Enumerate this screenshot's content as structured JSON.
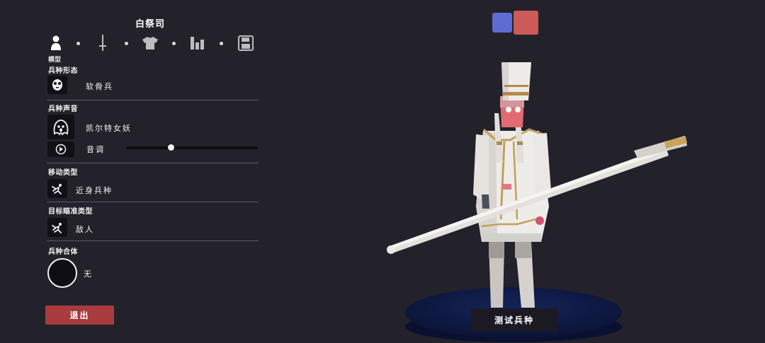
{
  "unit_name": "白祭司",
  "tabs": [
    {
      "name": "model",
      "caption": "模型",
      "icon": "person-icon",
      "active": true
    },
    {
      "name": "weapon",
      "icon": "sword-icon"
    },
    {
      "name": "clothing",
      "icon": "shirt-icon"
    },
    {
      "name": "stats",
      "icon": "bar-chart-icon"
    },
    {
      "name": "save",
      "icon": "save-icon"
    }
  ],
  "sections": {
    "unit_base": {
      "label": "兵种形态",
      "value": "软骨兵",
      "icon": "skull-mask-icon"
    },
    "unit_voice": {
      "label": "兵种声音",
      "value": "凯尔特女妖",
      "icon": "banshee-icon",
      "pitch_label": "音调",
      "pitch_value": 0.34,
      "play_icon": "play-icon"
    },
    "movement": {
      "label": "移动类型",
      "value": "近身兵种",
      "icon": "melee-run-icon"
    },
    "targeting": {
      "label": "目标瞄准类型",
      "value": "敌人",
      "icon": "target-run-icon"
    },
    "unit_combo": {
      "label": "兵种合体",
      "value": "无"
    }
  },
  "exit_label": "退出",
  "test_label": "测试兵种",
  "team_colors": {
    "blue": "#5d6ed0",
    "red": "#cc5a58"
  },
  "colors": {
    "background": "#23222b",
    "exit_button": "#a83b3d",
    "platform": "#0f1a3f"
  }
}
